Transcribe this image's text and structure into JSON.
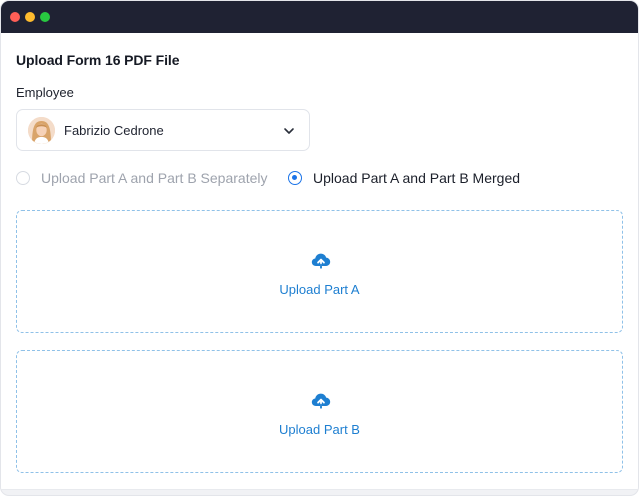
{
  "window": {
    "controls": [
      "close",
      "minimize",
      "maximize"
    ]
  },
  "form": {
    "title": "Upload Form 16 PDF File",
    "employee_label": "Employee",
    "employee_select": {
      "value": "Fabrizio Cedrone",
      "avatar_icon": "user-avatar",
      "chevron_icon": "chevron-down-icon"
    },
    "upload_mode": {
      "options": [
        {
          "label": "Upload Part A and Part B Separately",
          "checked": false,
          "disabled": true
        },
        {
          "label": "Upload Part A and Part B Merged",
          "checked": true,
          "disabled": false
        }
      ]
    },
    "dropzones": [
      {
        "label": "Upload Part A",
        "icon": "cloud-upload-icon"
      },
      {
        "label": "Upload Part B",
        "icon": "cloud-upload-icon"
      }
    ]
  },
  "colors": {
    "titlebar": "#1f2233",
    "accent": "#1a73e8",
    "dropzone_border": "#8fc1e8",
    "link": "#1e7fd1"
  }
}
